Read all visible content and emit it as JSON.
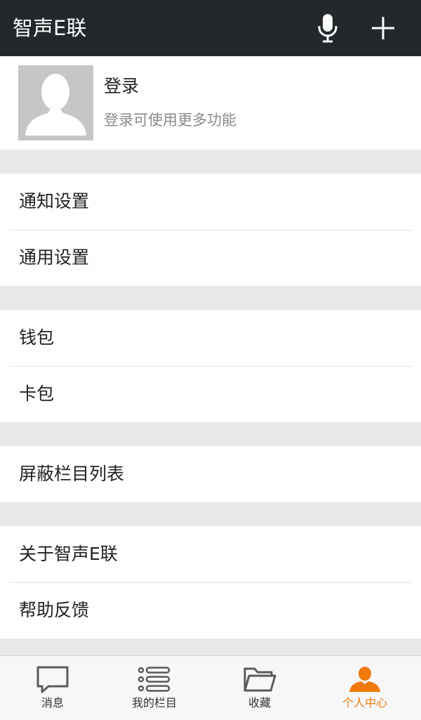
{
  "header": {
    "title": "智声E联",
    "icons": [
      "microphone-icon",
      "plus-icon"
    ]
  },
  "profile": {
    "name": "登录",
    "subtitle": "登录可使用更多功能"
  },
  "menu": {
    "groups": [
      {
        "items": [
          {
            "label": "通知设置"
          },
          {
            "label": "通用设置"
          }
        ]
      },
      {
        "items": [
          {
            "label": "钱包"
          },
          {
            "label": "卡包"
          }
        ]
      },
      {
        "items": [
          {
            "label": "屏蔽栏目列表"
          }
        ]
      },
      {
        "items": [
          {
            "label": "关于智声E联"
          },
          {
            "label": "帮助反馈"
          }
        ]
      }
    ]
  },
  "tabs": [
    {
      "label": "消息",
      "icon": "chat-bubble-icon",
      "active": false
    },
    {
      "label": "我的栏目",
      "icon": "list-icon",
      "active": false
    },
    {
      "label": "收藏",
      "icon": "folder-icon",
      "active": false
    },
    {
      "label": "个人中心",
      "icon": "person-icon",
      "active": true
    }
  ],
  "colors": {
    "header_bg": "#22282b",
    "accent": "#f07a0c",
    "page_bg": "#e8e8e8"
  }
}
